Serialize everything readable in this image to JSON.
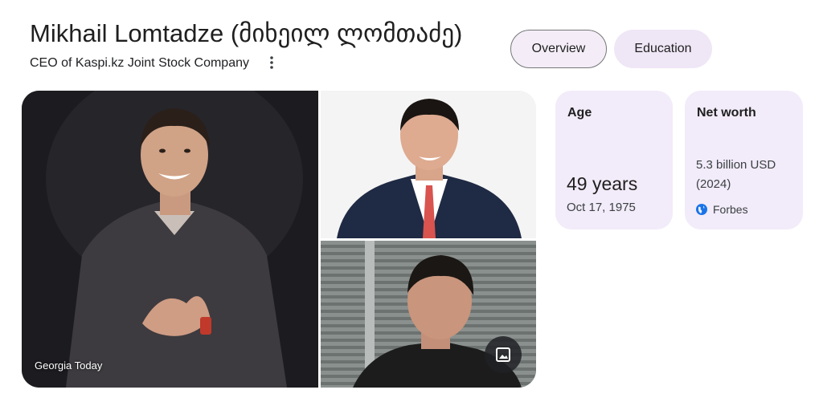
{
  "header": {
    "title": "Mikhail Lomtadze (მიხეილ ლომთაძე)",
    "subtitle": "CEO of Kaspi.kz Joint Stock Company"
  },
  "tabs": [
    {
      "label": "Overview"
    },
    {
      "label": "Education"
    }
  ],
  "images": {
    "main_credit": "Georgia Today"
  },
  "facts": {
    "age": {
      "label": "Age",
      "value": "49 years",
      "date": "Oct 17, 1975"
    },
    "net_worth": {
      "label": "Net worth",
      "value": "5.3 billion USD (2024)",
      "source": "Forbes"
    }
  },
  "colors": {
    "chip_bg": "#efe6f6",
    "card_bg": "#f2ebf9",
    "source_icon": "#1a73e8"
  },
  "icons": [
    "more-vert-icon",
    "image-icon",
    "globe-icon"
  ]
}
